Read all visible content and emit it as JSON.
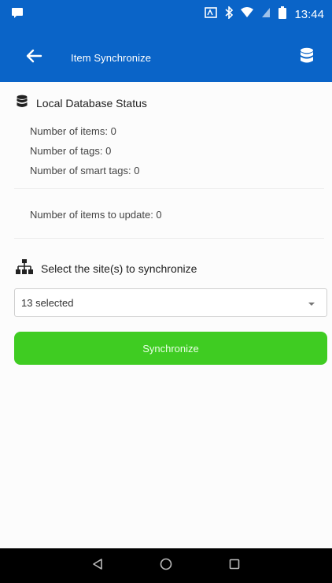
{
  "status_bar": {
    "time": "13:44",
    "icons": [
      "notification-icon",
      "cast-icon",
      "bluetooth-icon",
      "wifi-icon",
      "signal-icon",
      "battery-icon"
    ]
  },
  "toolbar": {
    "title": "Item Synchronize",
    "back_icon": "arrow-left-icon",
    "action_icon": "database-icon"
  },
  "local_db": {
    "header": "Local Database Status",
    "items_line": "Number of items: 0",
    "tags_line": "Number of tags: 0",
    "smart_tags_line": "Number of smart tags: 0",
    "update_line": "Number of items to update: 0"
  },
  "sites": {
    "header": "Select the site(s) to synchronize",
    "selected": "13 selected"
  },
  "actions": {
    "synchronize": "Synchronize"
  },
  "colors": {
    "primary": "#0a64c8",
    "button": "#3fcc22",
    "nav_bar": "#000000"
  }
}
